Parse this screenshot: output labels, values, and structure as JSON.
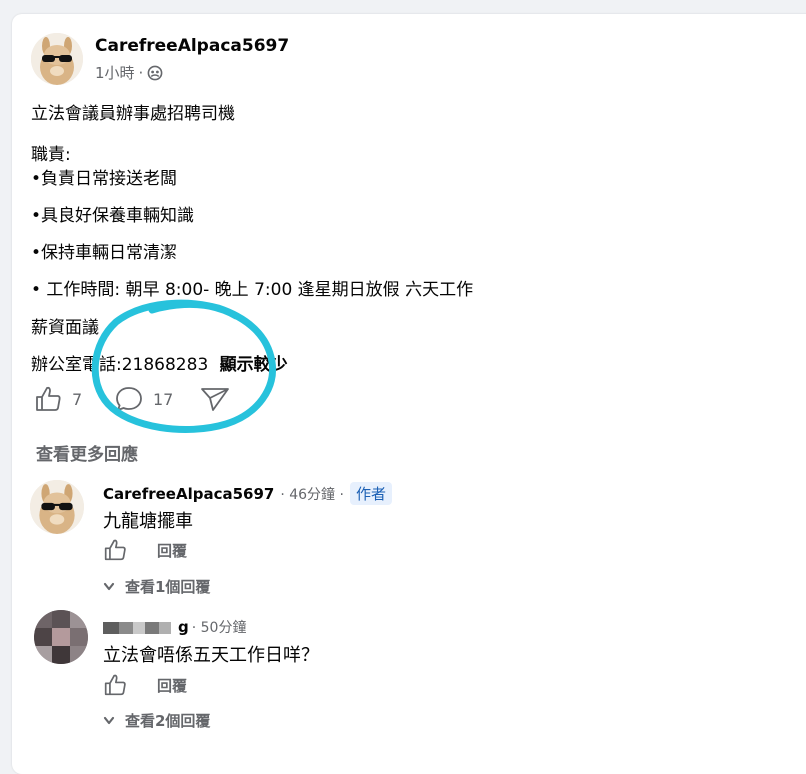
{
  "post": {
    "author": "CarefreeAlpaca5697",
    "time": "1小時",
    "separator": "·",
    "lines": [
      "立法會議員辦事處招聘司機",
      "職責:",
      "•負責日常接送老闆",
      "•具良好保養車輛知識",
      "•保持車輛日常清潔",
      "• 工作時間: 朝早 8:00- 晚上 7:00 逢星期日放假 六天工作",
      "薪資面議"
    ],
    "phone_line": "辦公室電話:21868283",
    "show_less": "顯示較少",
    "likes": "7",
    "comments": "17"
  },
  "view_more_comments": "查看更多回應",
  "comments": [
    {
      "author": "CarefreeAlpaca5697",
      "time": "· 46分鐘 ·",
      "badge": "作者",
      "text": "九龍塘擺車",
      "reply_label": "回覆",
      "view_replies": "查看1個回覆"
    },
    {
      "author_suffix": "g",
      "time": "· 50分鐘",
      "text": "立法會唔係五天工作日咩？",
      "reply_label": "回覆",
      "view_replies": "查看2個回覆"
    }
  ],
  "colors": {
    "annotation_circle": "#27c2dc",
    "secondary_text": "#65676b",
    "author_badge_bg": "#e7f0fd"
  }
}
